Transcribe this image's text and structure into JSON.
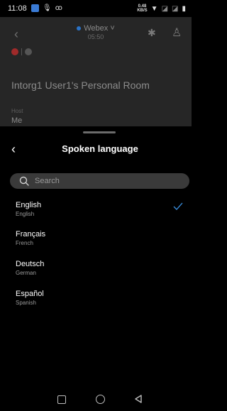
{
  "status_bar": {
    "time": "11:08",
    "speed": "0.48",
    "speed_unit": "KB/S"
  },
  "meeting": {
    "app_name": "Webex",
    "timer": "05:50",
    "room_name": "Intorg1 User1's Personal Room",
    "host_label": "Host",
    "host_value": "Me"
  },
  "sheet": {
    "title": "Spoken language",
    "search_placeholder": "Search",
    "languages": [
      {
        "name": "English",
        "subtitle": "English",
        "selected": true
      },
      {
        "name": "Français",
        "subtitle": "French",
        "selected": false
      },
      {
        "name": "Deutsch",
        "subtitle": "German",
        "selected": false
      },
      {
        "name": "Español",
        "subtitle": "Spanish",
        "selected": false
      }
    ]
  },
  "colors": {
    "accent_check": "#3a8fe0",
    "sheet_bg": "#000000",
    "dimmed_bg": "#262626",
    "search_bg": "#3a3a3a"
  }
}
